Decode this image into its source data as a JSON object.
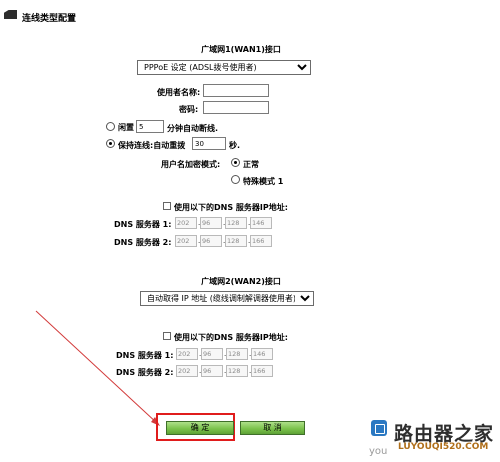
{
  "header": {
    "title": "连线类型配置"
  },
  "wan1": {
    "title": "广域网1(WAN1)接口",
    "connection_type": "PPPoE 设定 (ADSL拨号使用者)",
    "username_label": "使用者名称:",
    "username_value": "",
    "password_label": "密码:",
    "password_value": "",
    "idle_label": "闲置",
    "idle_value": "5",
    "idle_suffix": "分钟自动断线.",
    "keepalive_label": "保持连线:自动重拨",
    "keepalive_value": "30",
    "keepalive_suffix": "秒.",
    "encrypt_label": "用户名加密模式:",
    "mode_normal": "正常",
    "mode_special": "特殊模式 1",
    "dns_checkbox_label": "使用以下的DNS 服务器IP地址:",
    "dns1_label": "DNS 服务器 1:",
    "dns1": [
      "202",
      "96",
      "128",
      "146"
    ],
    "dns2_label": "DNS 服务器 2:",
    "dns2": [
      "202",
      "96",
      "128",
      "166"
    ]
  },
  "wan2": {
    "title": "广域网2(WAN2)接口",
    "connection_type": "自动取得 IP 地址 (缆线调制解调器使用者)",
    "dns_checkbox_label": "使用以下的DNS 服务器IP地址:",
    "dns1_label": "DNS 服务器 1:",
    "dns1": [
      "202",
      "96",
      "128",
      "146"
    ],
    "dns2_label": "DNS 服务器 2:",
    "dns2": [
      "202",
      "96",
      "128",
      "166"
    ]
  },
  "buttons": {
    "ok": "确 定",
    "cancel": "取 消"
  },
  "watermark": {
    "site_cn": "路由器之家",
    "site_url": "LUYOUQI520.COM",
    "site_url2": "you"
  },
  "colors": {
    "highlight": "#e01c1c",
    "button": "#7cc34d",
    "arrow": "#d23a3a"
  }
}
